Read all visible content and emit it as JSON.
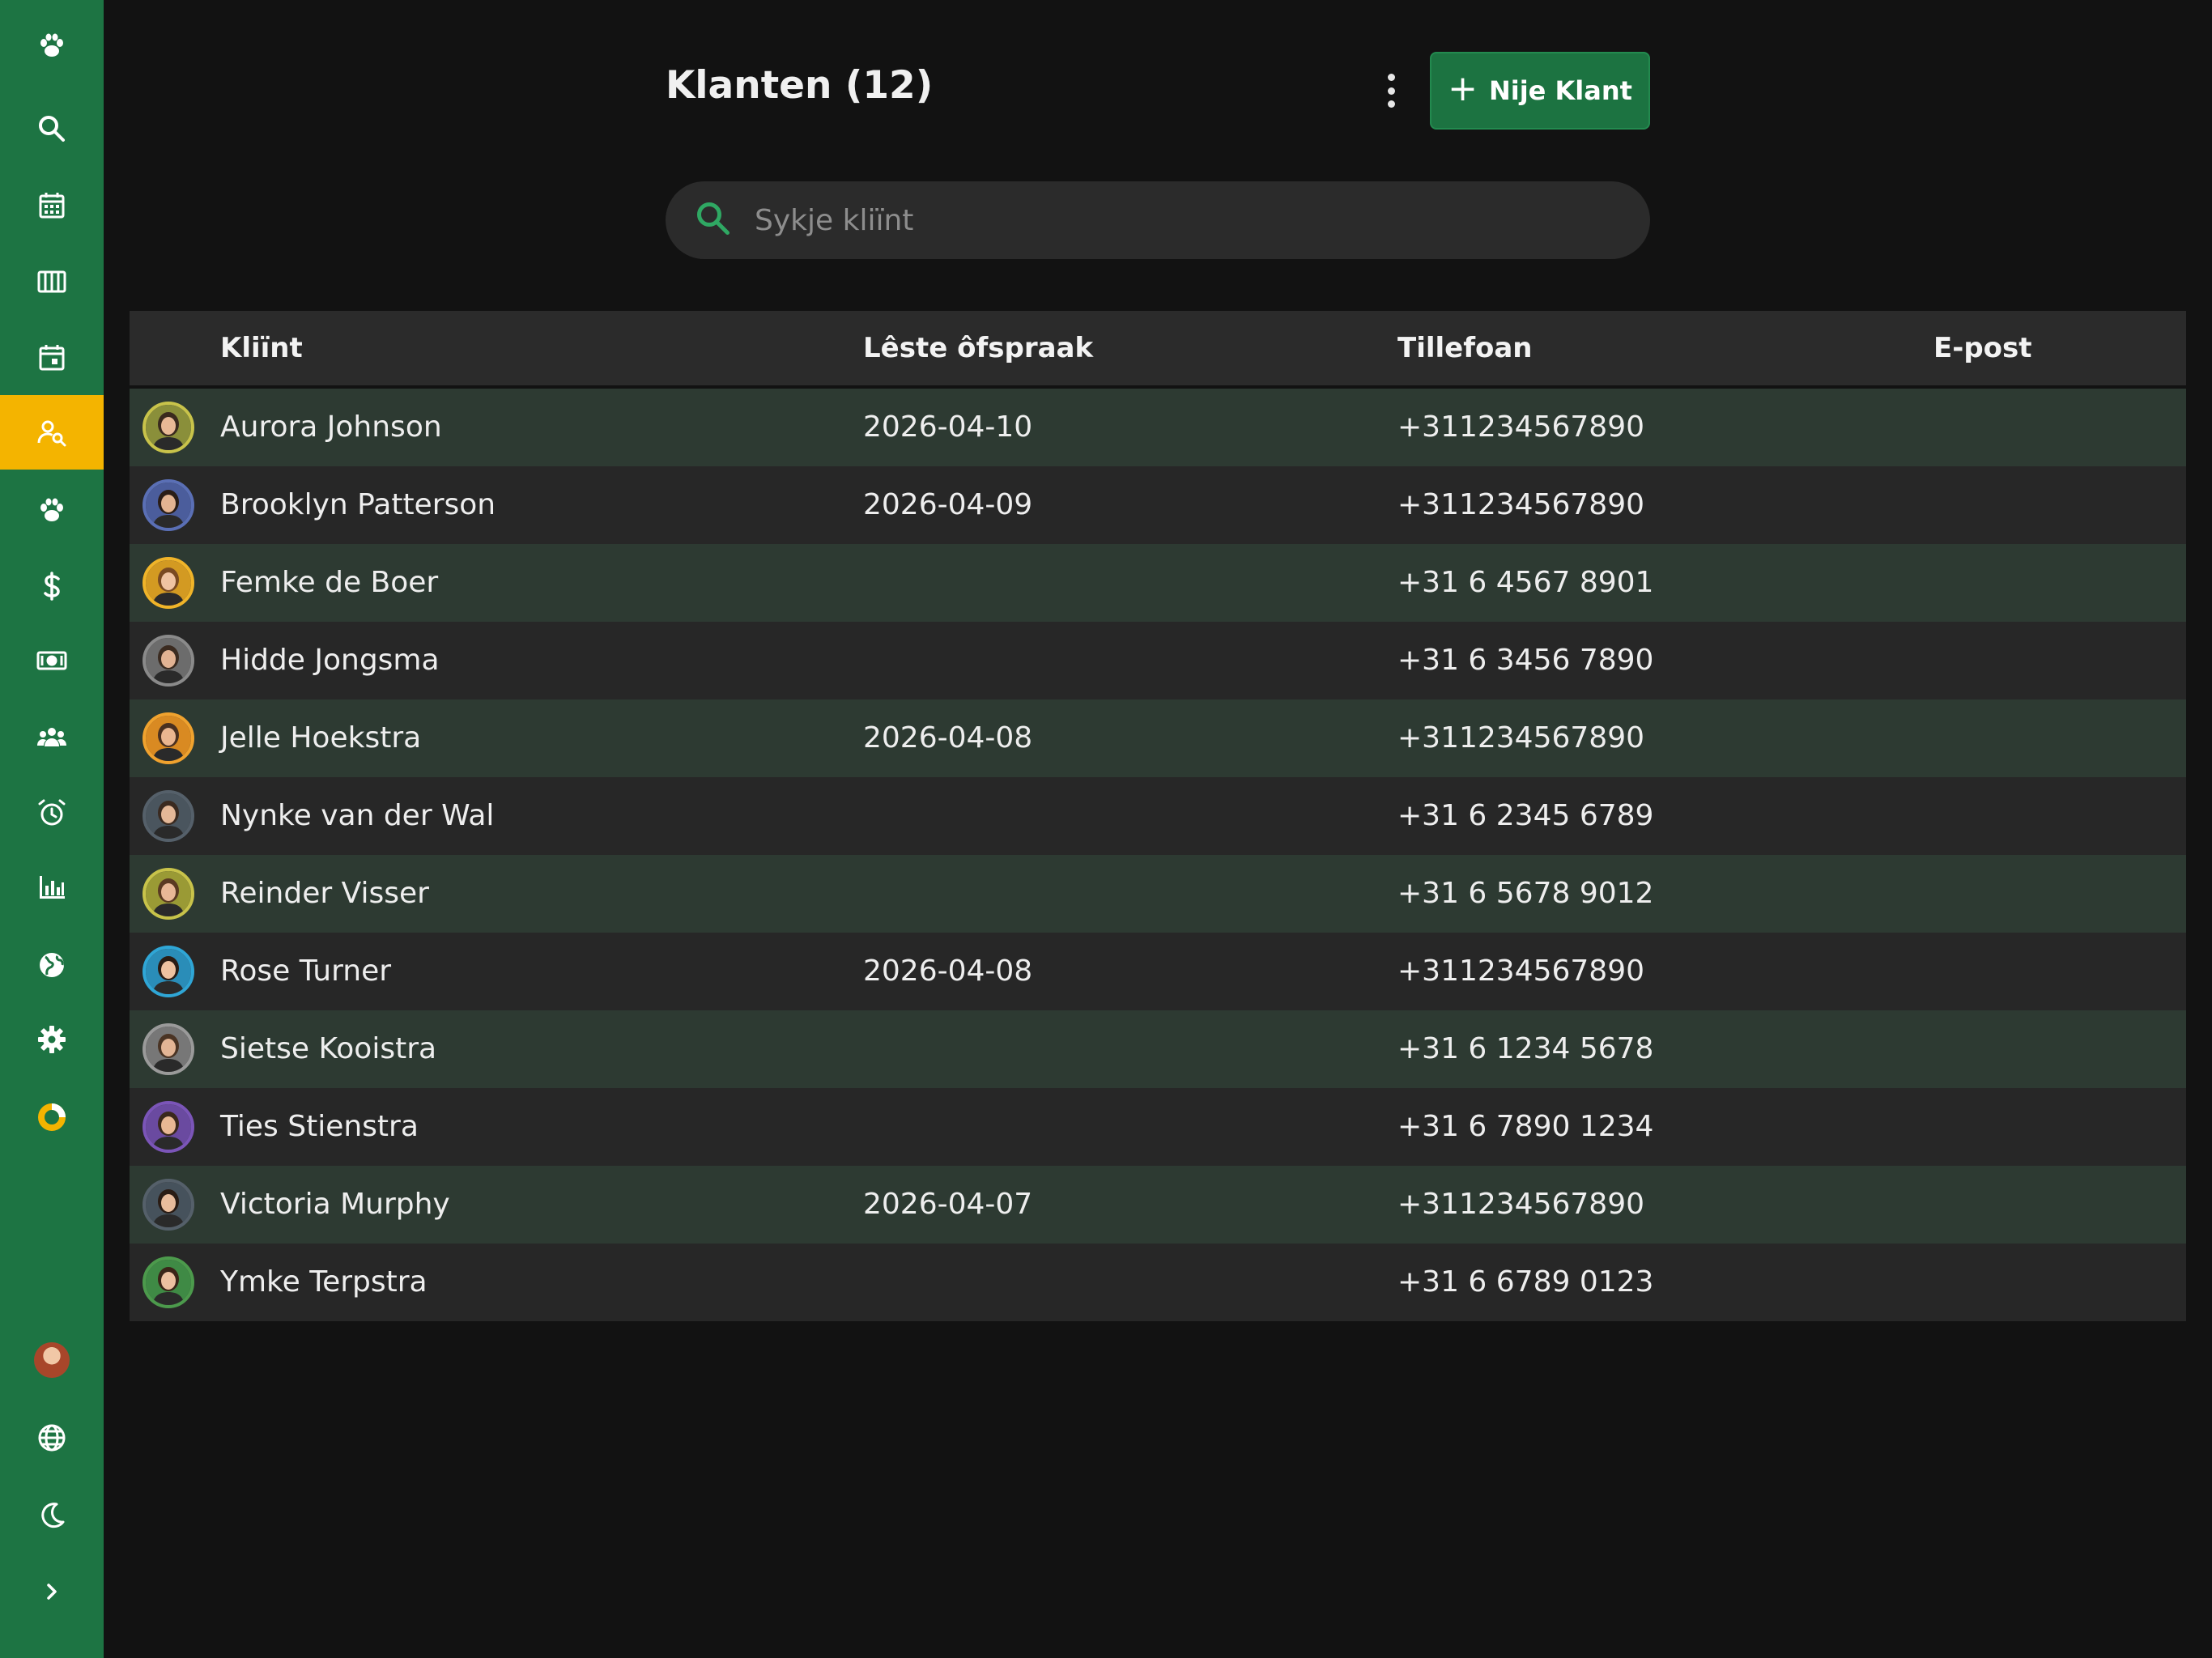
{
  "header": {
    "title": "Klanten (12)",
    "new_button_label": "Nije Klant",
    "search_placeholder": "Sykje kliïnt"
  },
  "sidebar": {
    "items": [
      {
        "icon": "paw-logo-icon"
      },
      {
        "icon": "search-icon"
      },
      {
        "icon": "calendar-grid-icon"
      },
      {
        "icon": "columns-icon"
      },
      {
        "icon": "calendar-day-icon"
      },
      {
        "icon": "client-search-icon",
        "active": true
      },
      {
        "icon": "paw-icon"
      },
      {
        "icon": "dollar-icon"
      },
      {
        "icon": "banknote-icon"
      },
      {
        "icon": "group-icon"
      },
      {
        "icon": "alarm-clock-icon"
      },
      {
        "icon": "bar-chart-icon"
      },
      {
        "icon": "globe-icon"
      },
      {
        "icon": "gear-icon"
      },
      {
        "icon": "donut-icon"
      }
    ],
    "bottom": [
      {
        "icon": "user-avatar"
      },
      {
        "icon": "language-globe-icon"
      },
      {
        "icon": "moon-icon"
      },
      {
        "icon": "chevron-right-icon"
      }
    ]
  },
  "table": {
    "headers": {
      "client": "Kliïnt",
      "last_appointment": "Lêste ôfspraak",
      "phone": "Tillefoan",
      "email": "E-post"
    },
    "rows": [
      {
        "name": "Aurora Johnson",
        "last": "2026-04-10",
        "phone": "+311234567890",
        "email": "",
        "ring": "#c8c34a",
        "bg": "#8a8f3a",
        "skin": "#e8b996",
        "hair": "#3a2a1e"
      },
      {
        "name": "Brooklyn Patterson",
        "last": "2026-04-09",
        "phone": "+311234567890",
        "email": "",
        "ring": "#5a6fb5",
        "bg": "#4b5d9c",
        "skin": "#e3b492",
        "hair": "#2a1d16"
      },
      {
        "name": "Femke de Boer",
        "last": "",
        "phone": "+31 6 4567 8901",
        "email": "",
        "ring": "#f0b429",
        "bg": "#d39a22",
        "skin": "#f0c4a2",
        "hair": "#7a4a22"
      },
      {
        "name": "Hidde Jongsma",
        "last": "",
        "phone": "+31 6 3456 7890",
        "email": "",
        "ring": "#8a8a8a",
        "bg": "#6c6c6c",
        "skin": "#e2b393",
        "hair": "#3b2b20"
      },
      {
        "name": "Jelle Hoekstra",
        "last": "2026-04-08",
        "phone": "+311234567890",
        "email": "",
        "ring": "#f0a22e",
        "bg": "#d98a22",
        "skin": "#eab690",
        "hair": "#4a3020"
      },
      {
        "name": "Nynke van der Wal",
        "last": "",
        "phone": "+31 6 2345 6789",
        "email": "",
        "ring": "#55606a",
        "bg": "#4a555e",
        "skin": "#e4b898",
        "hair": "#3a2a20"
      },
      {
        "name": "Reinder Visser",
        "last": "",
        "phone": "+31 6 5678 9012",
        "email": "",
        "ring": "#c8c34a",
        "bg": "#9a9a35",
        "skin": "#e8b896",
        "hair": "#5a3a22"
      },
      {
        "name": "Rose Turner",
        "last": "2026-04-08",
        "phone": "+311234567890",
        "email": "",
        "ring": "#2fa6d6",
        "bg": "#2a8db8",
        "skin": "#eec2a0",
        "hair": "#2a1c14"
      },
      {
        "name": "Sietse Kooistra",
        "last": "",
        "phone": "+31 6 1234 5678",
        "email": "",
        "ring": "#9a9a9a",
        "bg": "#777777",
        "skin": "#e3b595",
        "hair": "#4a3424"
      },
      {
        "name": "Ties Stienstra",
        "last": "",
        "phone": "+31 6 7890 1234",
        "email": "",
        "ring": "#7b55b8",
        "bg": "#6a4aa0",
        "skin": "#e9b894",
        "hair": "#3a281c"
      },
      {
        "name": "Victoria Murphy",
        "last": "2026-04-07",
        "phone": "+311234567890",
        "email": "",
        "ring": "#55606a",
        "bg": "#46525c",
        "skin": "#e8bc9c",
        "hair": "#2a1c14"
      },
      {
        "name": "Ymke Terpstra",
        "last": "",
        "phone": "+31 6 6789 0123",
        "email": "",
        "ring": "#4c9a4c",
        "bg": "#3f8a45",
        "skin": "#ecc0a0",
        "hair": "#3a2418"
      }
    ]
  },
  "colors": {
    "sidebar": "#1d7443",
    "active": "#f4b400",
    "primary_button": "#1c7341",
    "row_odd": "#2d3a32",
    "row_even": "#272727"
  }
}
